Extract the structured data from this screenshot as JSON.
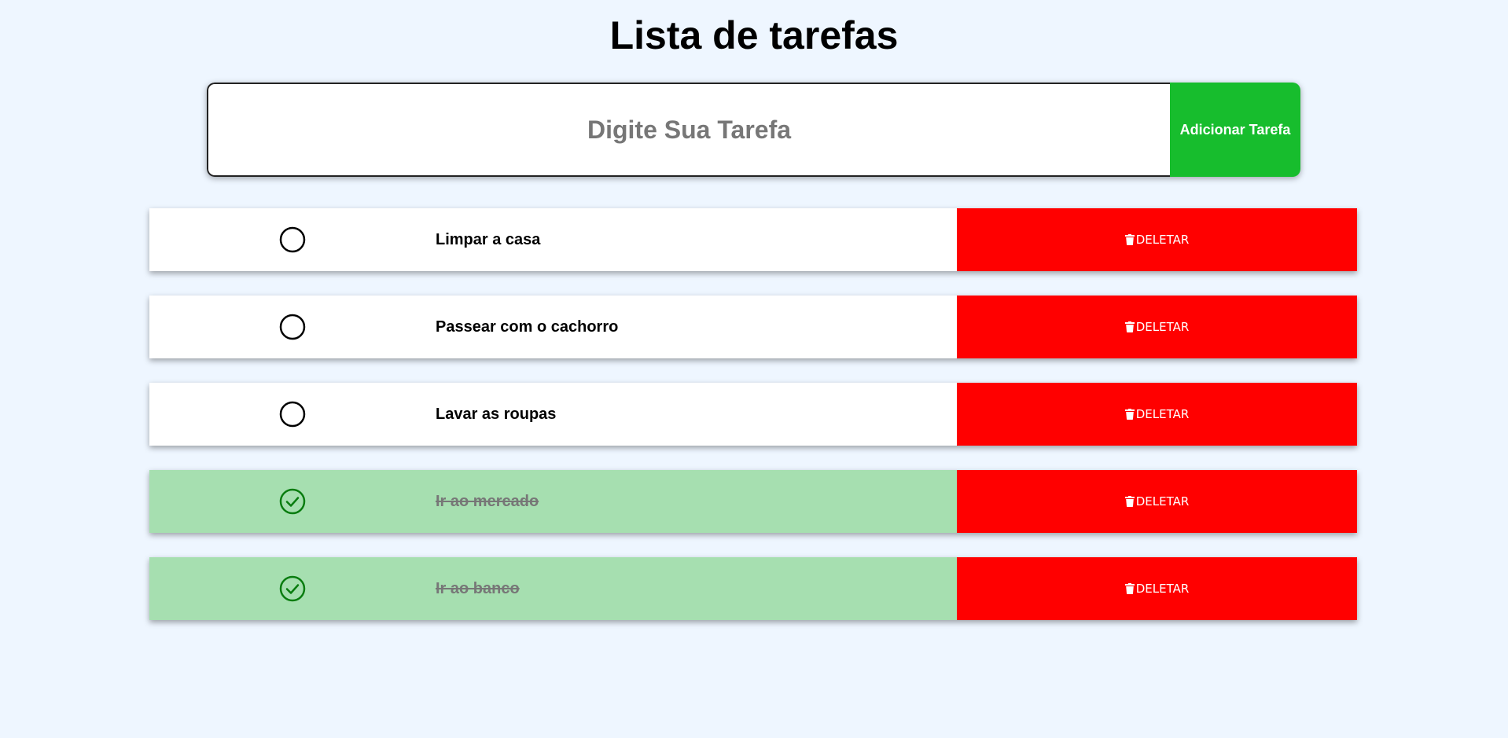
{
  "header": {
    "title": "Lista de tarefas"
  },
  "add_form": {
    "placeholder": "Digite Sua Tarefa",
    "button_label": "Adicionar Tarefa"
  },
  "tasks": [
    {
      "text": "Limpar a casa",
      "completed": false,
      "delete_label": "DELETAR"
    },
    {
      "text": "Passear com o cachorro",
      "completed": false,
      "delete_label": "DELETAR"
    },
    {
      "text": "Lavar as roupas",
      "completed": false,
      "delete_label": "DELETAR"
    },
    {
      "text": "Ir ao mercado",
      "completed": true,
      "delete_label": "DELETAR"
    },
    {
      "text": "Ir ao banco",
      "completed": true,
      "delete_label": "DELETAR"
    }
  ],
  "colors": {
    "background": "#eef6ff",
    "add_button": "#17bd2d",
    "delete_button": "#ff0000",
    "completed_row": "#a6dfb0",
    "check_done": "#0a7d10"
  },
  "icons": {
    "pending": "circle-icon",
    "completed": "check-circle-icon",
    "delete": "trash-icon"
  }
}
